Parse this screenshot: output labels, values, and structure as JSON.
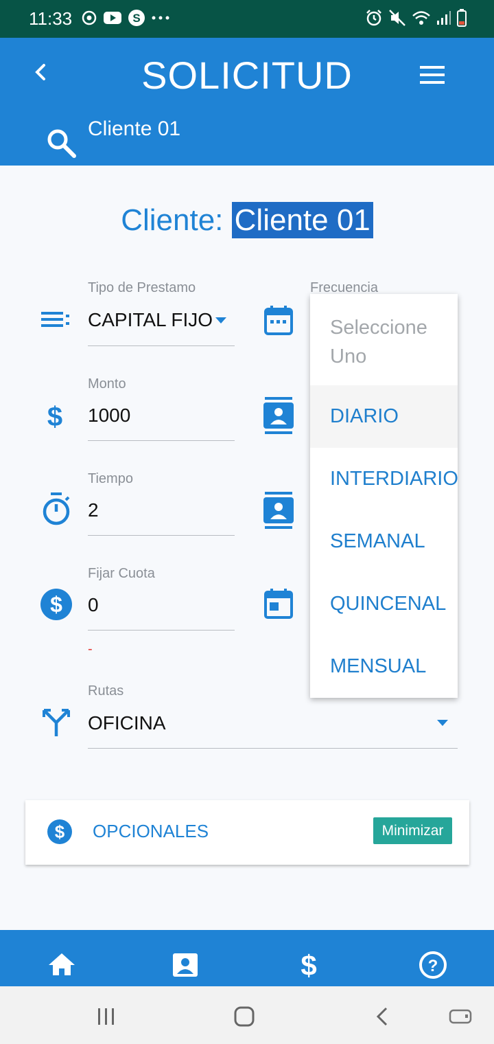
{
  "status_bar": {
    "time": "11:33",
    "left_icons": [
      "sync-icon",
      "youtube-icon",
      "skype-icon",
      "more-dots-icon"
    ],
    "right_icons": [
      "alarm-icon",
      "mute-icon",
      "wifi-icon",
      "signal-icon",
      "battery-icon"
    ]
  },
  "header": {
    "title": "SOLICITUD",
    "search_value": "Cliente 01"
  },
  "client": {
    "label": "Cliente:",
    "name": "Cliente 01"
  },
  "form": {
    "tipo_prestamo": {
      "label": "Tipo de Prestamo",
      "value": "CAPITAL FIJO"
    },
    "frecuencia": {
      "label": "Frecuencia"
    },
    "monto": {
      "label": "Monto",
      "value": "1000"
    },
    "tiempo": {
      "label": "Tiempo",
      "value": "2"
    },
    "fijar_cuota": {
      "label": "Fijar Cuota",
      "value": "0",
      "helper": "-"
    },
    "rutas": {
      "label": "Rutas",
      "value": "OFICINA"
    }
  },
  "frecuencia_dropdown": {
    "placeholder": "Seleccione Uno",
    "options": [
      "DIARIO",
      "INTERDIARIO",
      "SEMANAL",
      "QUINCENAL",
      "MENSUAL"
    ],
    "highlighted": "DIARIO"
  },
  "opcionales": {
    "label": "OPCIONALES",
    "button": "Minimizar"
  },
  "bottom_nav": [
    "home-icon",
    "contact-icon",
    "dollar-icon",
    "help-icon"
  ],
  "system_nav": [
    "recent-apps-icon",
    "home-button-icon",
    "back-button-icon",
    "keyboard-hide-icon"
  ],
  "colors": {
    "primary": "#1f83d5",
    "status_bar": "#075446",
    "accent_button": "#26a69a",
    "highlight": "#1f6cc5"
  }
}
